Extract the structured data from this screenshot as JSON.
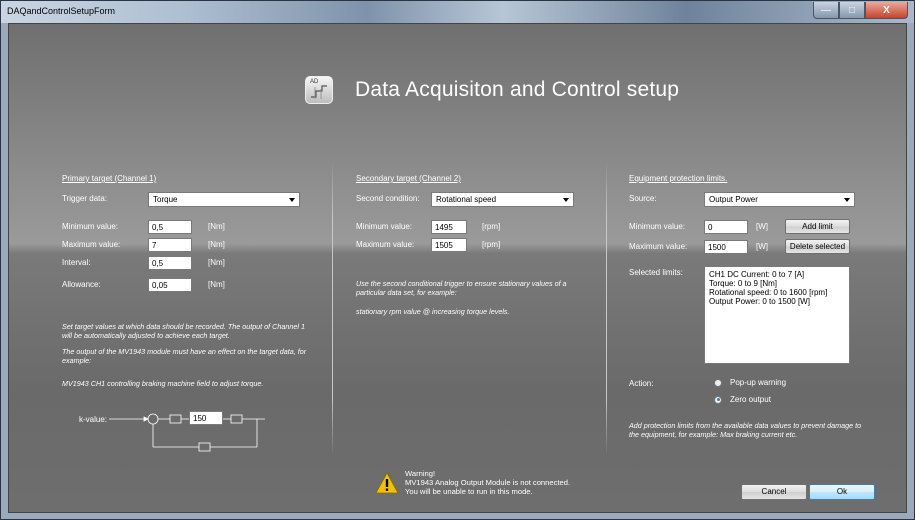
{
  "window": {
    "title": "DAQandControlSetupForm",
    "buttons": {
      "minimize": "—",
      "maximize": "□",
      "close": "X"
    }
  },
  "header": {
    "title": "Data Acquisiton and Control setup",
    "icon": "ad-converter-icon",
    "icon_label": "AD"
  },
  "primary": {
    "title": "Primary target (Channel 1)",
    "trigger_label": "Trigger data:",
    "trigger_value": "Torque",
    "fields": [
      {
        "label": "Minimum value:",
        "value": "0,5",
        "unit": "[Nm]"
      },
      {
        "label": "Maximum value:",
        "value": "7",
        "unit": "[Nm]"
      },
      {
        "label": "Interval:",
        "value": "0,5",
        "unit": "[Nm]"
      },
      {
        "label": "Allowance:",
        "value": "0,05",
        "unit": "[Nm]"
      }
    ],
    "note1": "Set target values at which data should be recorded. The output of Channel 1 will be automatically adjusted to achieve each target.",
    "note2": "The output of the MV1943 module must have an effect on the target data, for example:",
    "note3": "MV1943 CH1 controlling braking machine field to adjust torque.",
    "k_label": "k-value:",
    "k_value": "150"
  },
  "secondary": {
    "title": "Secondary target (Channel 2)",
    "condition_label": "Second condition:",
    "condition_value": "Rotational speed",
    "fields": [
      {
        "label": "Minimum value:",
        "value": "1495",
        "unit": "[rpm]"
      },
      {
        "label": "Maximum value:",
        "value": "1505",
        "unit": "[rpm]"
      }
    ],
    "note1": "Use the second conditional trigger to ensure stationary values of a particular data set, for example:",
    "note2": "stationary rpm value @ increasing torque levels."
  },
  "protection": {
    "title": "Equipment protection limits.",
    "source_label": "Source:",
    "source_value": "Output Power",
    "fields": [
      {
        "label": "Minimum value:",
        "value": "0",
        "unit": "[W]"
      },
      {
        "label": "Maximum value:",
        "value": "1500",
        "unit": "[W]"
      }
    ],
    "add_limit": "Add limit",
    "delete_selected": "Delete selected",
    "selected_label": "Selected limits:",
    "limits": [
      "CH1 DC Current: 0 to 7 [A]",
      "Torque: 0 to 9 [Nm]",
      "Rotational speed: 0 to 1600 [rpm]",
      "Output Power: 0 to 1500 [W]"
    ],
    "action_label": "Action:",
    "actions": [
      {
        "label": "Pop-up warning",
        "selected": false
      },
      {
        "label": "Zero output",
        "selected": true
      }
    ],
    "note": "Add protection limits from the available data values to prevent damage to the equipment, for example: Max braking current etc."
  },
  "warning": {
    "line1": "Warning!",
    "line2": "MV1943 Analog Output Module is not connected.",
    "line3": "You will be unable to run in this mode."
  },
  "footer": {
    "cancel": "Cancel",
    "ok": "Ok"
  },
  "colors": {
    "accent": "#2f7fd0",
    "warning": "#f2c200"
  }
}
